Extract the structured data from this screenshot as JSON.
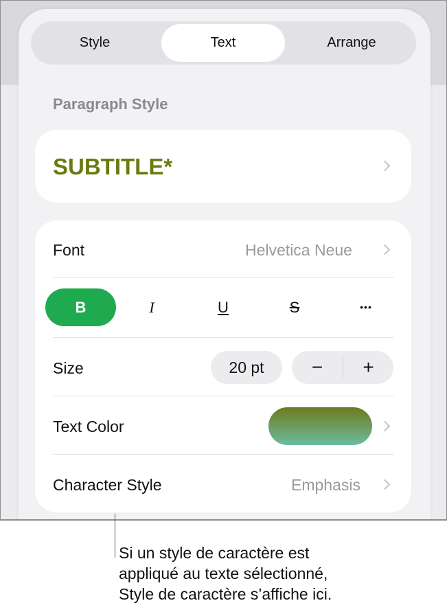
{
  "tabs": [
    {
      "label": "Style"
    },
    {
      "label": "Text",
      "selected": true
    },
    {
      "label": "Arrange"
    }
  ],
  "paragraph_style": {
    "heading": "Paragraph Style",
    "value": "SUBTITLE*",
    "color": "#6b7a0f"
  },
  "font": {
    "label": "Font",
    "value": "Helvetica Neue"
  },
  "format_buttons": {
    "bold": "B",
    "italic": "I",
    "underline": "U",
    "strike": "S",
    "more": "•••",
    "bold_active": true,
    "accent": "#1faa4f"
  },
  "size": {
    "label": "Size",
    "value": "20 pt",
    "minus": "−",
    "plus": "+"
  },
  "text_color": {
    "label": "Text Color",
    "swatch_top": "#6f7a1c",
    "swatch_bottom": "#6cbba1"
  },
  "character_style": {
    "label": "Character Style",
    "value": "Emphasis"
  },
  "callout": {
    "line1": "Si un style de caractère est",
    "line2": "appliqué au texte sélectionné,",
    "line3": "Style de caractère s’affiche ici."
  }
}
